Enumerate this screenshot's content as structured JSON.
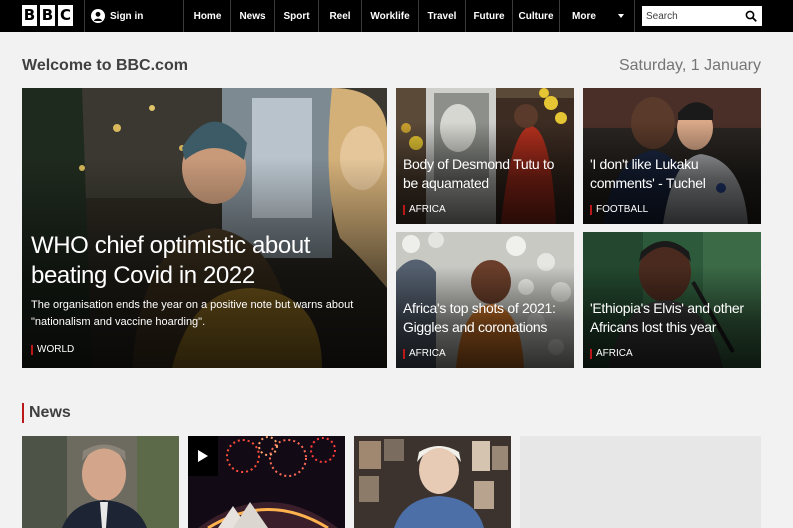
{
  "header": {
    "logo_letters": [
      "B",
      "B",
      "C"
    ],
    "signin_label": "Sign in",
    "nav_items": [
      "Home",
      "News",
      "Sport",
      "Reel",
      "Worklife",
      "Travel",
      "Future",
      "Culture"
    ],
    "more_label": "More",
    "search_placeholder": "Search"
  },
  "welcome": {
    "title": "Welcome to BBC.com",
    "date": "Saturday, 1 January"
  },
  "hero": {
    "title": "WHO chief optimistic about beating Covid in 2022",
    "summary": "The organisation ends the year on a positive note but warns about \"nationalism and vaccine hoarding\".",
    "tag": "WORLD"
  },
  "stories": [
    {
      "title": "Body of Desmond Tutu to be aquamated",
      "tag": "AFRICA"
    },
    {
      "title": "'I don't like Lukaku comments' - Tuchel",
      "tag": "FOOTBALL"
    },
    {
      "title": "Africa's top shots of 2021: Giggles and coronations",
      "tag": "AFRICA"
    },
    {
      "title": "'Ethiopia's Elvis' and other Africans lost this year",
      "tag": "AFRICA"
    }
  ],
  "news": {
    "heading": "News"
  },
  "colors": {
    "topbar": "#000000",
    "accent_red": "#bb1919",
    "page_bg": "#f2f2f2"
  },
  "icons": [
    "user-icon",
    "chevron-down-icon",
    "search-icon",
    "play-icon"
  ]
}
